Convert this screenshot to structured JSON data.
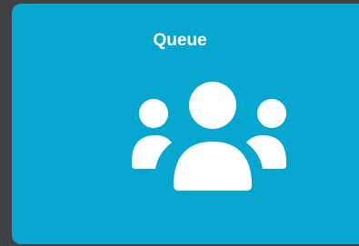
{
  "tile": {
    "title": "Queue",
    "icon": "users-group-icon",
    "background_color": "#05a7cf",
    "icon_color": "#ffffff"
  },
  "page": {
    "background_color": "#3f4143"
  }
}
